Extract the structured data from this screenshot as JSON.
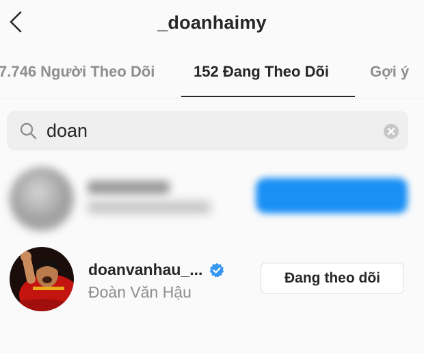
{
  "header": {
    "title": "_doanhaimy",
    "back_icon": "chevron-left-icon"
  },
  "tabs": [
    {
      "label": "7.746 Người Theo Dõi",
      "active": false
    },
    {
      "label": "152 Đang Theo Dõi",
      "active": true
    },
    {
      "label": "Gợi ý",
      "active": false
    }
  ],
  "search": {
    "value": "doan",
    "icon": "search-icon",
    "clear_icon": "clear-icon"
  },
  "results": [
    {
      "redacted": true,
      "button_color": "#1a90f5"
    },
    {
      "username": "doanvanhau_...",
      "full_name": "Đoàn Văn Hậu",
      "verified": true,
      "verified_color": "#3897f0",
      "button_label": "Đang theo dõi"
    }
  ],
  "colors": {
    "primary_text": "#262626",
    "secondary_text": "#8e8e8e",
    "background": "#fafafa",
    "search_bg": "#efefef"
  }
}
